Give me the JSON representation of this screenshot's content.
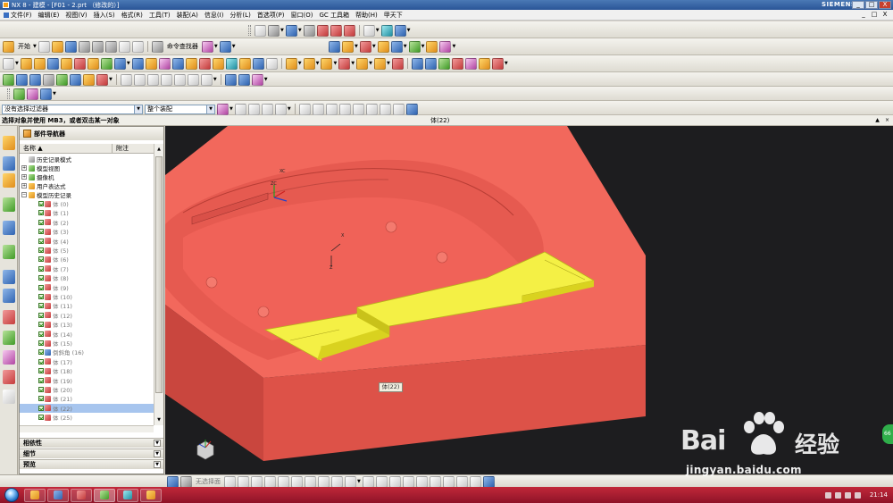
{
  "titlebar": {
    "title": "NX 8 - 建模 - [F01 - 2.prt （修改的）]",
    "brand": "SIEMENS",
    "buttons": [
      "_",
      "□",
      "X"
    ]
  },
  "menubar": {
    "items": [
      "文件(F)",
      "编辑(E)",
      "视图(V)",
      "插入(S)",
      "格式(R)",
      "工具(T)",
      "装配(A)",
      "信息(I)",
      "分析(L)",
      "首选项(P)",
      "窗口(O)",
      "GC 工具箱",
      "帮助(H)",
      "甲天下"
    ],
    "mdi_buttons": [
      "_",
      "□",
      "X"
    ]
  },
  "toolbar": {
    "start_label": "开始",
    "command_finder": "命令查找器",
    "filter_value": "没有选择过滤器",
    "assembly_value": "整个装配"
  },
  "statusbar": {
    "prompt": "选择对象并使用 MB3，或者双击某一对象",
    "selection": "体(22)"
  },
  "navigator": {
    "title": "部件导航器",
    "columns": {
      "name": "名称",
      "note": "附注"
    },
    "nodes": [
      {
        "label": "历史记录模式",
        "level": 0
      },
      {
        "label": "模型视图",
        "level": 0
      },
      {
        "label": "摄像机",
        "level": 0
      },
      {
        "label": "用户表达式",
        "level": 0
      },
      {
        "label": "模型历史记录",
        "level": 0
      }
    ],
    "items": [
      "体 (0)",
      "体 (1)",
      "体 (2)",
      "体 (3)",
      "体 (4)",
      "体 (5)",
      "体 (6)",
      "体 (7)",
      "体 (8)",
      "体 (9)",
      "体 (10)",
      "体 (11)",
      "体 (12)",
      "体 (13)",
      "体 (14)",
      "体 (15)",
      "倒斜角 (16)",
      "体 (17)",
      "体 (18)",
      "体 (19)",
      "体 (20)",
      "体 (21)",
      "体 (22)",
      "体 (25)"
    ],
    "selected_index": 22,
    "sections": [
      "相依性",
      "细节",
      "预览"
    ]
  },
  "viewport": {
    "tooltip": "体(22)",
    "wcs_labels": {
      "xc": "XC",
      "zc": "ZC",
      "x": "X",
      "z": "Z"
    }
  },
  "bottombar": {
    "label": "无选择面"
  },
  "taskbar": {
    "clock": "21:14"
  },
  "watermark": {
    "logo": "Bai",
    "logo_cn": "经验",
    "url": "jingyan.baidu.com"
  },
  "bubble": {
    "text": "66"
  },
  "colors": {
    "model_body": "#f0645a",
    "model_side": "#d9534a",
    "highlight": "#f4f045",
    "viewport_bg": "#1d1d1f",
    "taskbar": "#a81c30"
  }
}
